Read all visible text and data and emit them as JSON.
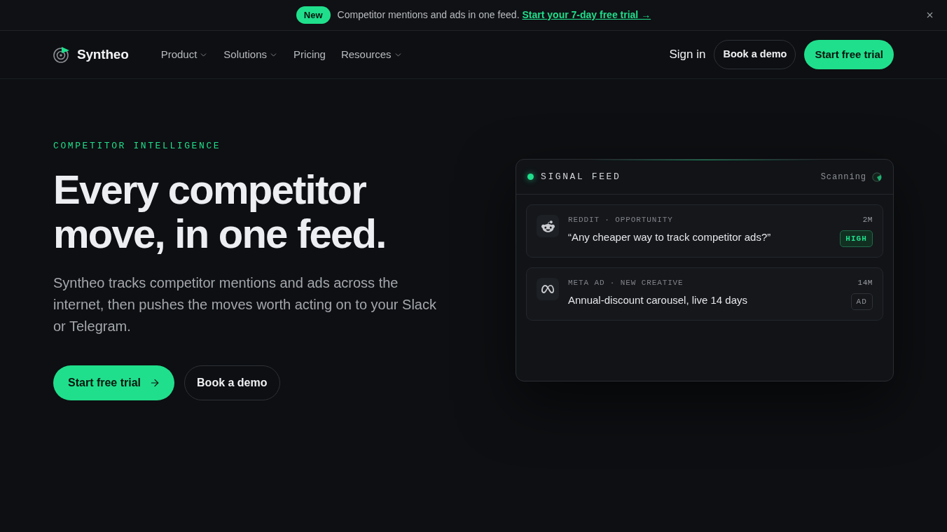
{
  "announcement": {
    "badge": "New",
    "text": "Competitor mentions and ads in one feed.",
    "link": "Start your 7-day free trial →"
  },
  "nav": {
    "brand": "Syntheo",
    "items": [
      {
        "label": "Product",
        "dropdown": true
      },
      {
        "label": "Solutions",
        "dropdown": true
      },
      {
        "label": "Pricing",
        "dropdown": false
      },
      {
        "label": "Resources",
        "dropdown": true
      }
    ],
    "sign_in": "Sign in",
    "secondary_button": "Book a demo",
    "primary_button": "Start free trial"
  },
  "hero": {
    "eyebrow": "COMPETITOR INTELLIGENCE",
    "heading_lines": [
      "Every competitor",
      "move, in one feed."
    ],
    "body": "Syntheo tracks competitor mentions and ads across the internet, then pushes the moves worth acting on to your Slack or Telegram.",
    "primary_button": "Start free trial",
    "secondary_button": "Book a demo"
  },
  "feed": {
    "title": "SIGNAL FEED",
    "status": "Scanning",
    "items": [
      {
        "kind": "reddit",
        "source": "REDDIT · OPPORTUNITY",
        "text": "“Any cheaper way to track competitor ads?”",
        "time": "2M",
        "tag": "HIGH",
        "highlighted": true
      },
      {
        "kind": "meta",
        "source": "META AD · NEW CREATIVE",
        "text": "Annual-discount carousel, live 14 days",
        "time": "14M",
        "tag": "AD",
        "highlighted": false
      }
    ]
  }
}
